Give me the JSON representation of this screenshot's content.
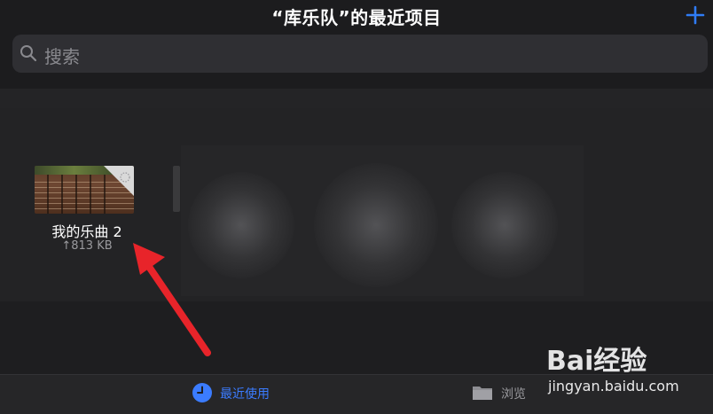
{
  "header": {
    "title": "“库乐队”的最近项目",
    "add_icon": "plus-icon",
    "accent_color": "#2f7cf6"
  },
  "search": {
    "placeholder": "搜索",
    "icon": "search-icon"
  },
  "files": [
    {
      "name": "我的乐曲 2",
      "size": "↑813 KB",
      "thumbnail": "guitar-fretboard-thumbnail",
      "status_icon": "cloud-sync-icon"
    }
  ],
  "annotation": {
    "arrow_color": "#e8242a"
  },
  "tabbar": {
    "recent": {
      "label": "最近使用",
      "icon": "clock-icon",
      "color": "#3b7cff"
    },
    "browse": {
      "label": "浏览",
      "icon": "folder-icon",
      "color": "#9a9a9e"
    }
  },
  "watermark": {
    "logo": "Bai经验",
    "url": "jingyan.baidu.com"
  }
}
